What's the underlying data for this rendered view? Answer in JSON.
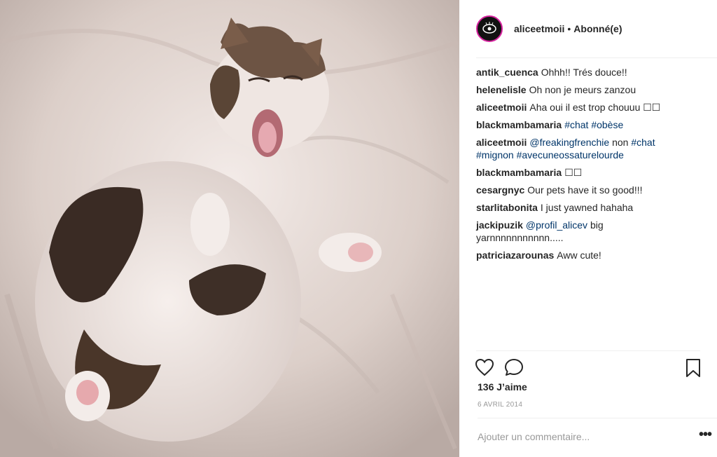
{
  "header": {
    "username": "aliceetmoii",
    "separator": "•",
    "follow_status": "Abonné(e)"
  },
  "comments": [
    {
      "user": "antik_cuenca",
      "text": "Ohhh!! Trés douce!!"
    },
    {
      "user": "helenelisle",
      "text": "Oh non je meurs zanzou"
    },
    {
      "user": "aliceetmoii",
      "text": "Aha oui il est trop chouuu ☐☐"
    },
    {
      "user": "blackmambamaria",
      "tags": [
        "#chat",
        "#obèse"
      ]
    },
    {
      "user": "aliceetmoii",
      "parts": [
        "@freakingfrenchie",
        "non",
        "#chat",
        "#mignon",
        "#avecuneossaturelourde"
      ]
    },
    {
      "user": "blackmambamaria",
      "text": "☐☐"
    },
    {
      "user": "cesargnyc",
      "text": "Our pets have it so good!!!"
    },
    {
      "user": "starlitabonita",
      "text": "I just yawned hahaha"
    },
    {
      "user": "jackipuzik",
      "mention": "@profil_alicev",
      "text": "big yarnnnnnnnnnnn....."
    },
    {
      "user": "patriciazarounas",
      "text": "Aww cute!"
    }
  ],
  "actions": {
    "like_icon": "heart-icon",
    "comment_icon": "comment-icon",
    "save_icon": "bookmark-icon"
  },
  "likes": "136 J’aime",
  "date": "6 AVRIL 2014",
  "add_comment": {
    "placeholder": "Ajouter un commentaire...",
    "more": "•••"
  },
  "colors": {
    "link": "#003569",
    "muted": "#999999",
    "text": "#262626",
    "border": "#efefef"
  }
}
